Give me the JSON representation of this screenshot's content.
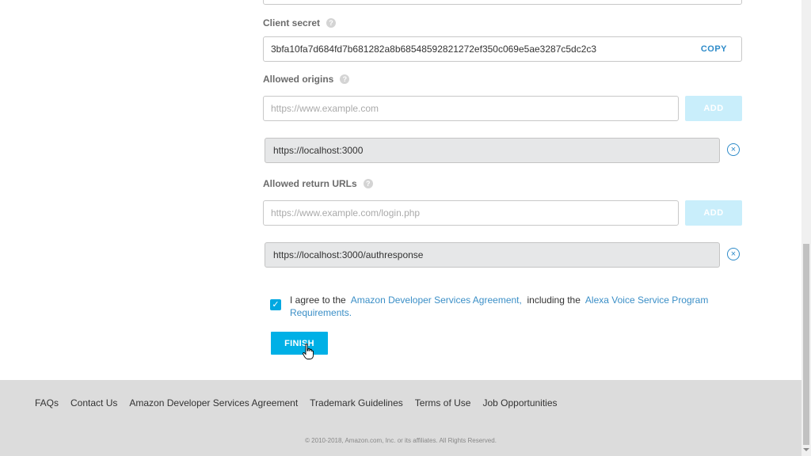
{
  "client_secret": {
    "label": "Client secret",
    "value": "3bfa10fa7d684fd7b681282a8b68548592821272ef350c069e5ae3287c5dc2c3",
    "copy_label": "COPY"
  },
  "allowed_origins": {
    "label": "Allowed origins",
    "placeholder": "https://www.example.com",
    "add_label": "ADD",
    "entries": [
      "https://localhost:3000"
    ]
  },
  "allowed_return_urls": {
    "label": "Allowed return URLs",
    "placeholder": "https://www.example.com/login.php",
    "add_label": "ADD",
    "entries": [
      "https://localhost:3000/authresponse"
    ]
  },
  "help_icon_glyph": "?",
  "agreement": {
    "checked": true,
    "prefix": "I agree to the",
    "link1": "Amazon Developer Services Agreement,",
    "middle": "including the",
    "link2_part1": "Alexa Voice Service Program",
    "link2_part2": "Requirements."
  },
  "finish_label": "FINISH",
  "footer": {
    "links": [
      "FAQs",
      "Contact Us",
      "Amazon Developer Services Agreement",
      "Trademark Guidelines",
      "Terms of Use",
      "Job Opportunities"
    ],
    "copyright": "© 2010-2018, Amazon.com, Inc. or its affiliates. All Rights Reserved."
  },
  "colors": {
    "accent": "#00b0e6",
    "link": "#3b8fc7",
    "add_disabled": "#c9eefb",
    "footer_bg": "#dcdcdc"
  },
  "icons": {
    "help": "help-icon",
    "remove": "remove-circle-icon",
    "check": "checkmark-icon",
    "cursor": "hand-cursor-icon"
  }
}
